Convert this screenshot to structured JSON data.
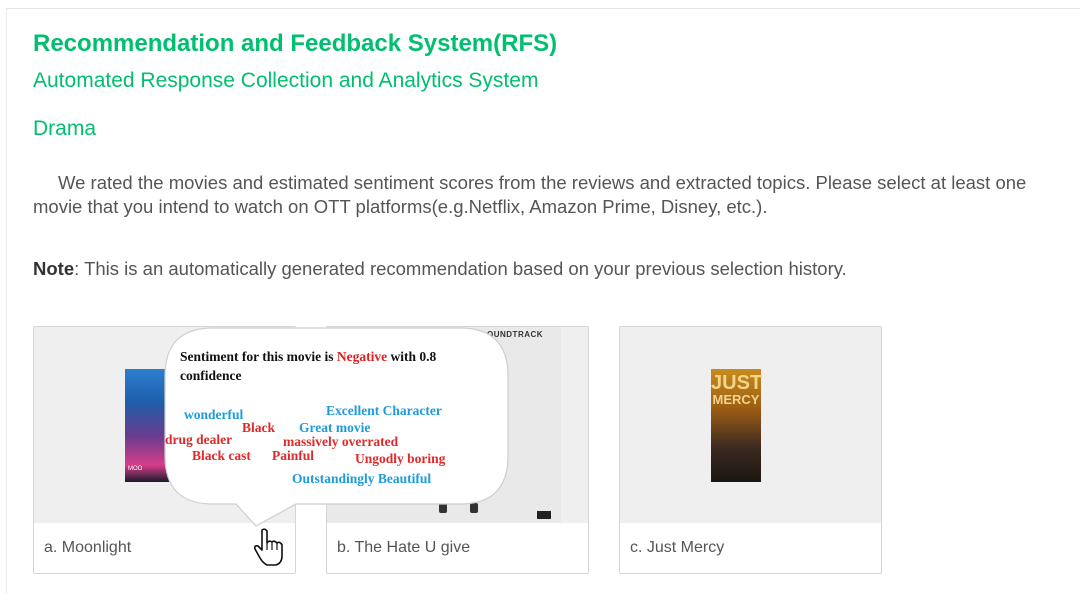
{
  "header": {
    "title": "Recommendation and Feedback System(RFS)",
    "subtitle": "Automated Response Collection and Analytics System"
  },
  "genre": "Drama",
  "description": "We rated the movies and estimated sentiment scores from the reviews and extracted topics. Please select at least one movie that you intend to watch on OTT platforms(e.g.Netflix, Amazon Prime, Disney, etc.).",
  "note": {
    "label": "Note",
    "text": ": This is an automatically generated recommendation based on your previous selection history."
  },
  "movies": [
    {
      "label": "a. Moonlight"
    },
    {
      "label": "b. The Hate U give",
      "poster_text": "OUNDTRACK"
    },
    {
      "label": "c. Just Mercy",
      "poster_line1": "JUST",
      "poster_line2": "MERCY"
    }
  ],
  "tooltip": {
    "prefix": "Sentiment for this movie is ",
    "sentiment": "Negative",
    "suffix": " with 0.8 confidence",
    "topics": [
      {
        "text": "wonderful",
        "tone": "positive"
      },
      {
        "text": "Excellent Character",
        "tone": "positive"
      },
      {
        "text": "Black",
        "tone": "negative"
      },
      {
        "text": "Great movie",
        "tone": "positive"
      },
      {
        "text": "drug dealer",
        "tone": "negative"
      },
      {
        "text": "massively overrated",
        "tone": "negative"
      },
      {
        "text": "Black cast",
        "tone": "negative"
      },
      {
        "text": "Painful",
        "tone": "negative"
      },
      {
        "text": "Ungodly boring",
        "tone": "negative"
      },
      {
        "text": "Outstandingly Beautiful",
        "tone": "positive"
      }
    ]
  },
  "colors": {
    "accent": "#00bf6f",
    "positive_topic": "#1e9bd9",
    "negative_topic": "#e02a2a",
    "negative_sentiment": "#e02020"
  },
  "icons": [
    "hand-pointer-icon"
  ]
}
